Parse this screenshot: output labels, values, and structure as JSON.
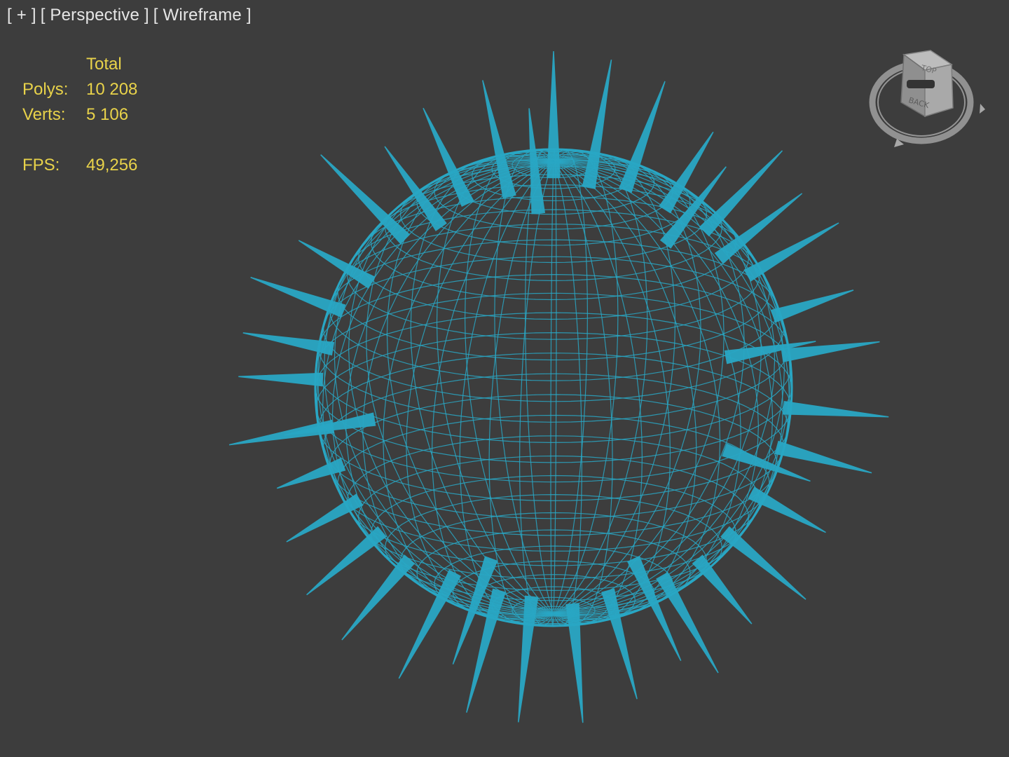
{
  "viewport": {
    "labels": {
      "plus": "[ + ]",
      "view": "[ Perspective ]",
      "shading": "[ Wireframe ]"
    },
    "stats": {
      "header": "Total",
      "polys_label": "Polys:",
      "polys_value": "10 208",
      "verts_label": "Verts:",
      "verts_value": "5 106",
      "fps_label": "FPS:",
      "fps_value": "49,256"
    },
    "viewcube": {
      "icon": "viewcube-icon",
      "face_top": "TOP",
      "face_back": "BACK"
    }
  },
  "colors": {
    "background": "#3d3d3d",
    "wireframe": "#29a7c4",
    "stats_text": "#e8d24a",
    "label_text": "#e6e6e6"
  }
}
